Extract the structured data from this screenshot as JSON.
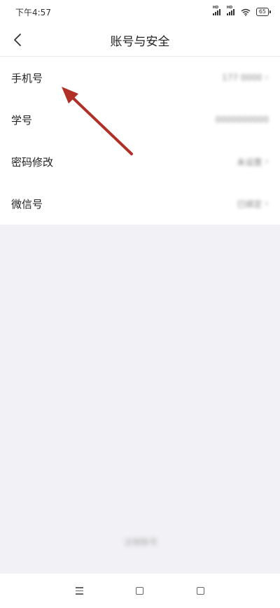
{
  "status_bar": {
    "time": "下午4:57",
    "signal_1_label": "HD",
    "signal_2_label": "HD",
    "battery": "65"
  },
  "nav": {
    "title": "账号与安全"
  },
  "rows": [
    {
      "label": "手机号",
      "value": "177 0000"
    },
    {
      "label": "学号",
      "value": "0000000000"
    },
    {
      "label": "密码修改",
      "value": "未设置"
    },
    {
      "label": "微信号",
      "value": "已绑定"
    }
  ],
  "bottom_link": "注销账号",
  "colors": {
    "annotation_arrow": "#b03028",
    "page_background": "#f2f2f6"
  }
}
